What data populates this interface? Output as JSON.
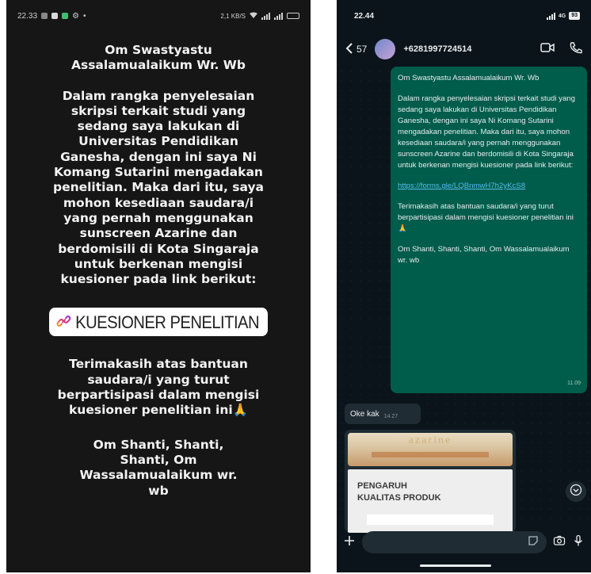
{
  "left_screen": {
    "status": {
      "time": "22.33",
      "right_text": "2,1 KB/S"
    },
    "story": {
      "paragraph1": "Om Swastyastu Assalamualaikum Wr. Wb",
      "paragraph2": "Dalam rangka penyelesaian skripsi terkait studi yang sedang saya lakukan di Universitas Pendidikan Ganesha, dengan ini saya Ni Komang Sutarini mengadakan penelitian. Maka dari itu, saya mohon kesediaan saudara/i yang pernah menggunakan sunscreen Azarine dan berdomisili di Kota Singaraja untuk berkenan mengisi kuesioner pada link berikut:",
      "link_label": "KUESIONER PENELITIAN",
      "paragraph3": "Terimakasih atas bantuan saudara/i yang turut berpartisipasi dalam mengisi kuesioner penelitian ini🙏",
      "paragraph4": "Om Shanti, Shanti, Shanti, Om Wassalamualaikum wr. wb"
    }
  },
  "right_screen": {
    "status": {
      "time": "22.44",
      "network": "4G",
      "battery": "93"
    },
    "header": {
      "back_count": "57",
      "contact": "+6281997724514"
    },
    "outgoing_message": {
      "p1": "Om Swastyastu Assalamualaikum Wr. Wb",
      "p2": "Dalam rangka penyelesaian skripsi terkait studi yang sedang saya lakukan di Universitas Pendidikan Ganesha, dengan ini saya Ni Komang Sutarini mengadakan penelitian. Maka dari itu, saya mohon kesediaan saudara/i yang pernah menggunakan sunscreen Azarine dan berdomisili di Kota Singaraja untuk berkenan mengisi kuesioner pada link berikut:",
      "link": "https://forms.gle/LQBnmwH7h2yKcS8",
      "p3": "Terimakasih atas bantuan saudara/i yang turut berpartisipasi dalam mengisi kuesioner penelitian ini🙏",
      "p4": "Om Shanti, Shanti, Shanti, Om Wassalamualaikum wr. wb",
      "time": "11.09"
    },
    "incoming_message": {
      "text": "Oke kak",
      "time": "14.27"
    },
    "document": {
      "brand": "azarine",
      "title_line1": "PENGARUH",
      "title_line2": "KUALITAS PRODUK"
    },
    "icons": {
      "back": "chevron-left-icon",
      "video": "video-call-icon",
      "call": "phone-icon",
      "scroll": "chevron-down-circle-icon",
      "attach": "plus-icon",
      "sticker": "sticker-icon",
      "camera": "camera-icon",
      "mic": "mic-icon"
    },
    "colors": {
      "outgoing_bubble": "#005c4b",
      "incoming_bubble": "#202c33",
      "background": "#0b141a",
      "link": "#53bdeb"
    }
  }
}
